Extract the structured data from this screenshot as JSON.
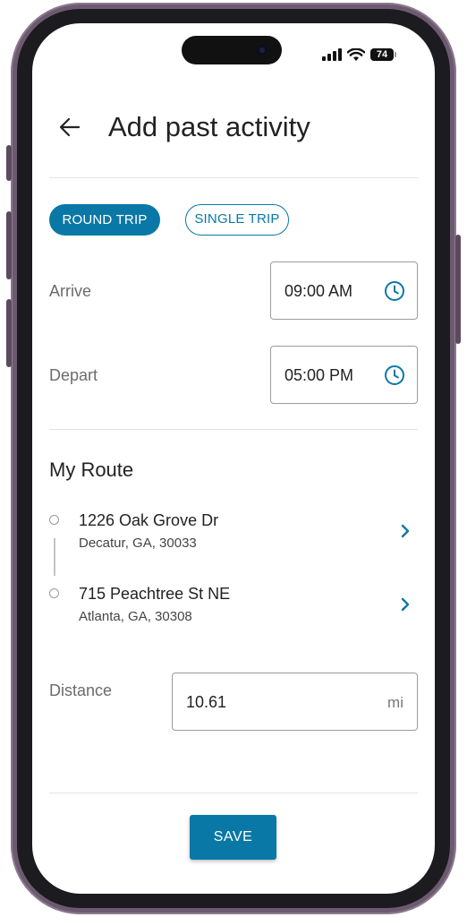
{
  "status_bar": {
    "battery_level": "74",
    "icons": [
      "signal-icon",
      "wifi-icon",
      "battery-icon"
    ]
  },
  "header": {
    "title": "Add past activity",
    "back_icon": "arrow-left-icon"
  },
  "trip_type": {
    "options": [
      {
        "label": "ROUND TRIP",
        "selected": true
      },
      {
        "label": "SINGLE TRIP",
        "selected": false
      }
    ]
  },
  "times": {
    "arrive": {
      "label": "Arrive",
      "value": "09:00 AM",
      "icon": "clock-icon"
    },
    "depart": {
      "label": "Depart",
      "value": "05:00 PM",
      "icon": "clock-icon"
    }
  },
  "route": {
    "title": "My Route",
    "stops": [
      {
        "line1": "1226 Oak Grove Dr",
        "line2": "Decatur, GA, 30033"
      },
      {
        "line1": "715 Peachtree St NE",
        "line2": "Atlanta, GA, 30308"
      }
    ]
  },
  "distance": {
    "label": "Distance",
    "value": "10.61",
    "unit": "mi"
  },
  "actions": {
    "save_label": "SAVE"
  },
  "colors": {
    "accent": "#0a78a6",
    "frame": "#6d5a70",
    "text": "#222222",
    "muted": "#6b6b6b"
  }
}
